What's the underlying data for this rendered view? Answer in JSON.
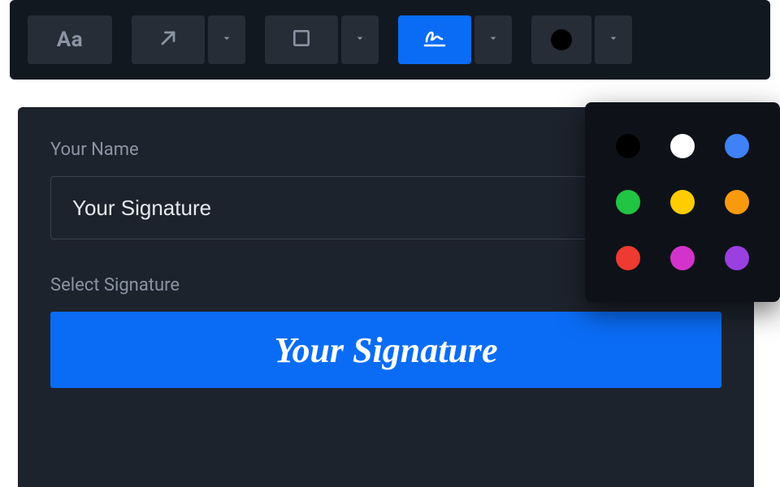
{
  "toolbar": {
    "text_tool_label": "Aa",
    "tools": {
      "text": "text-tool",
      "arrow": "arrow-tool",
      "rect": "rectangle-tool",
      "signature": "signature-tool",
      "color": "color-tool"
    },
    "active_tool": "signature-tool",
    "selected_color": "#000000"
  },
  "form": {
    "name_label": "Your Name",
    "name_value": "Your Signature",
    "select_label": "Select Signature",
    "signature_preview": "Your Signature"
  },
  "color_picker": {
    "open": true,
    "colors": {
      "black": "#000000",
      "white": "#ffffff",
      "blue": "#3f82f7",
      "green": "#22c443",
      "yellow": "#ffcc00",
      "orange": "#f99a0e",
      "red": "#ee3a30",
      "magenta": "#d433cb",
      "purple": "#9a3fe0"
    }
  }
}
